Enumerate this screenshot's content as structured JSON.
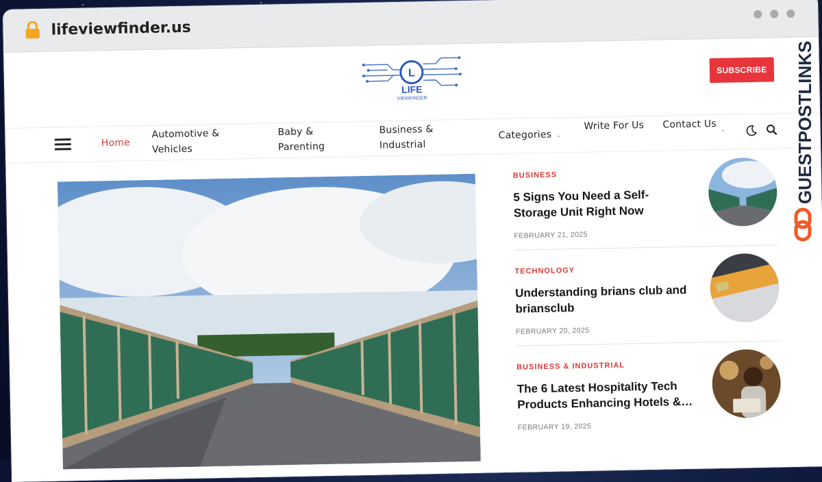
{
  "browser": {
    "url": "lifeviewfinder.us"
  },
  "header": {
    "logo_text": "LIFE",
    "logo_subtext": "VIEWFINDER",
    "logo_letter": "L",
    "subscribe_label": "SUBSCRIBE"
  },
  "nav": {
    "items": [
      {
        "label": "Home",
        "active": true
      },
      {
        "label": "Automotive & Vehicles"
      },
      {
        "label": "Baby & Parenting"
      },
      {
        "label": "Business & Industrial"
      },
      {
        "label": "Categories"
      },
      {
        "label": "Write For Us"
      },
      {
        "label": "Contact Us"
      }
    ]
  },
  "posts": [
    {
      "category": "BUSINESS",
      "title": "5 Signs You Need a Self-Storage Unit Right Now",
      "date": "FEBRUARY 21, 2025"
    },
    {
      "category": "TECHNOLOGY",
      "title": "Understanding brians club and briansclub",
      "date": "FEBRUARY 20, 2025"
    },
    {
      "category": "BUSINESS & INDUSTRIAL",
      "title": "The 6 Latest Hospitality Tech Products Enhancing Hotels &…",
      "date": "FEBRUARY 19, 2025"
    }
  ],
  "watermark": {
    "text": "GUESTPOSTLINKS"
  },
  "colors": {
    "accent": "#e8353b",
    "category": "#d83a3a",
    "watermark": "#1f2a40",
    "watermark_icon": "#f05a28"
  },
  "icons": [
    "lock-icon",
    "menu-icon",
    "moon-icon",
    "search-icon",
    "chevron-down-icon",
    "link-icon"
  ]
}
